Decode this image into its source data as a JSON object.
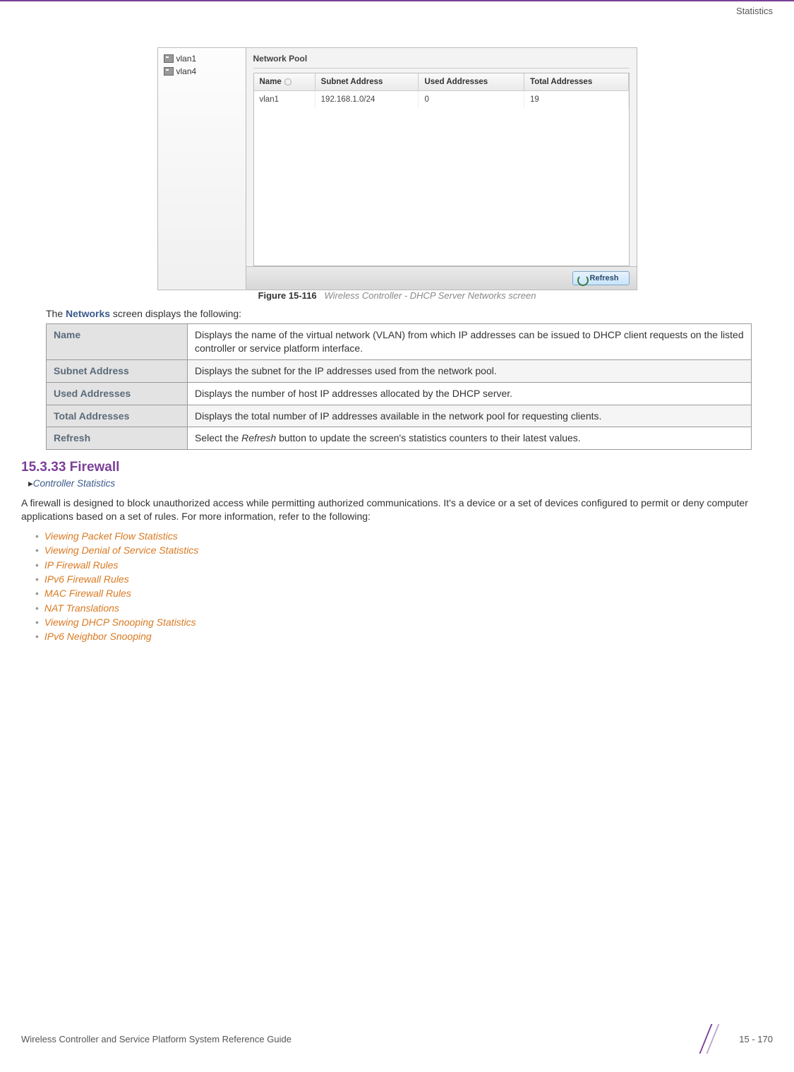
{
  "header": {
    "section_label": "Statistics"
  },
  "screenshot": {
    "sidebar_items": [
      "vlan1",
      "vlan4"
    ],
    "fieldset_title": "Network Pool",
    "table": {
      "headers": [
        "Name",
        "Subnet Address",
        "Used Addresses",
        "Total Addresses"
      ],
      "rows": [
        {
          "name": "vlan1",
          "subnet": "192.168.1.0/24",
          "used": "0",
          "total": "19"
        }
      ]
    },
    "refresh_label": "Refresh"
  },
  "figure": {
    "label": "Figure 15-116",
    "desc": "Wireless Controller - DHCP Server Networks screen"
  },
  "intro": {
    "prefix": "The ",
    "bold": "Networks",
    "suffix": " screen displays the following:"
  },
  "param_rows": [
    {
      "label": "Name",
      "desc": "Displays the name of the virtual network (VLAN) from which IP addresses can be issued to DHCP client requests on the listed controller or service platform interface."
    },
    {
      "label": "Subnet Address",
      "desc": "Displays the subnet for the IP addresses used from the network pool."
    },
    {
      "label": "Used Addresses",
      "desc": "Displays the number of host IP addresses allocated by the DHCP server."
    },
    {
      "label": "Total Addresses",
      "desc": "Displays the total number of IP addresses available in the network pool for requesting clients."
    },
    {
      "label": "Refresh",
      "desc_pre": "Select the ",
      "desc_em": "Refresh",
      "desc_post": " button to update the screen's statistics counters to their latest values."
    }
  ],
  "section": {
    "heading": "15.3.33 Firewall",
    "breadcrumb": "Controller Statistics"
  },
  "body": "A firewall is designed to block unauthorized access while permitting authorized communications. It's a device or a set of devices configured to permit or deny computer applications based on a set of rules. For more information, refer to the following:",
  "links": [
    "Viewing Packet Flow Statistics",
    "Viewing Denial of Service Statistics",
    "IP Firewall Rules",
    "IPv6 Firewall Rules",
    "MAC Firewall Rules",
    "NAT Translations",
    "Viewing DHCP Snooping Statistics",
    "IPv6 Neighbor Snooping"
  ],
  "footer": {
    "left": "Wireless Controller and Service Platform System Reference Guide",
    "page": "15 - 170"
  }
}
